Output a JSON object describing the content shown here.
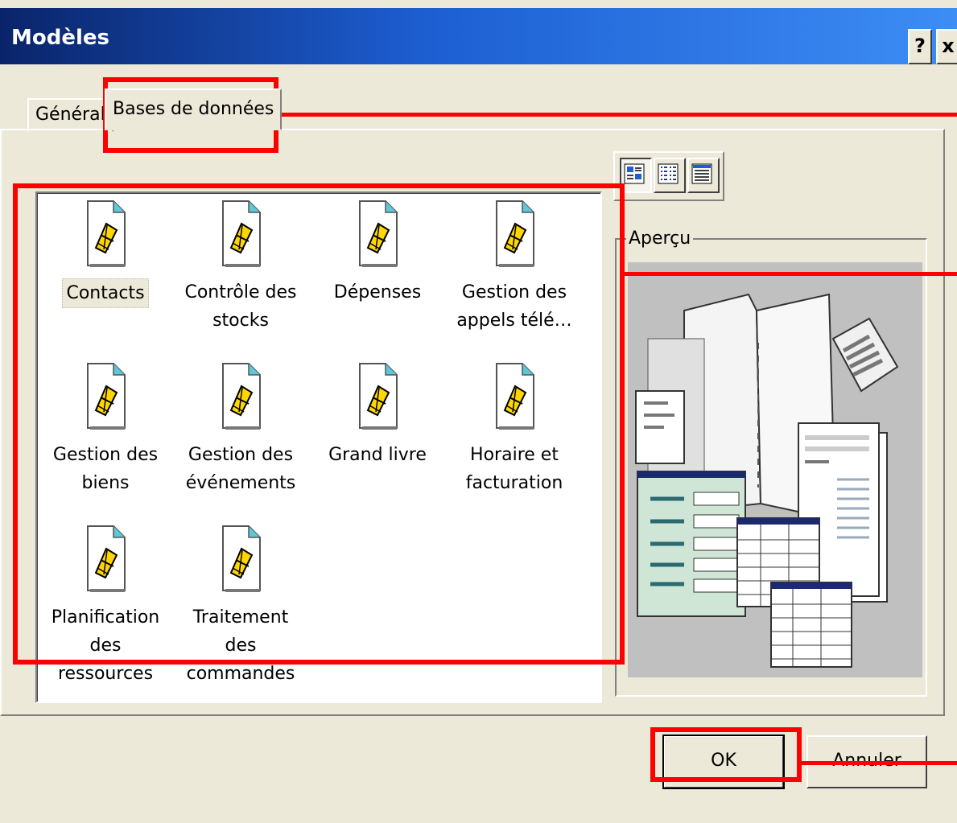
{
  "window": {
    "title": "Modèles",
    "help_btn": "?",
    "close_btn": "x"
  },
  "tabs": [
    {
      "label": "Général",
      "active": false
    },
    {
      "label": "Bases de données",
      "active": true
    }
  ],
  "templates": [
    {
      "label_line1": "Contacts",
      "label_line2": "",
      "icon": "database-template-icon",
      "selected": true
    },
    {
      "label_line1": "Contrôle des",
      "label_line2": "stocks",
      "icon": "database-template-icon",
      "selected": false
    },
    {
      "label_line1": "Dépenses",
      "label_line2": "",
      "icon": "database-template-icon",
      "selected": false
    },
    {
      "label_line1": "Gestion des",
      "label_line2": "appels télé…",
      "icon": "database-template-icon",
      "selected": false
    },
    {
      "label_line1": "Gestion des",
      "label_line2": "biens",
      "icon": "database-template-icon",
      "selected": false
    },
    {
      "label_line1": "Gestion des",
      "label_line2": "événements",
      "icon": "database-template-icon",
      "selected": false
    },
    {
      "label_line1": "Grand livre",
      "label_line2": "",
      "icon": "database-template-icon",
      "selected": false
    },
    {
      "label_line1": "Horaire et",
      "label_line2": "facturation",
      "icon": "database-template-icon",
      "selected": false
    },
    {
      "label_line1": "Planification des",
      "label_line2": "ressources",
      "icon": "database-template-icon",
      "selected": false
    },
    {
      "label_line1": "Traitement des",
      "label_line2": "commandes",
      "icon": "database-template-icon",
      "selected": false
    }
  ],
  "view_buttons": [
    {
      "icon": "large-icons-view-icon",
      "pressed": true
    },
    {
      "icon": "list-view-icon",
      "pressed": false
    },
    {
      "icon": "details-view-icon",
      "pressed": false
    }
  ],
  "preview": {
    "label": "Aperçu",
    "image": "database-preview-illustration"
  },
  "buttons": {
    "ok": "OK",
    "cancel": "Annuler"
  },
  "colors": {
    "titlebar_start": "#0a246a",
    "titlebar_end": "#3d8df5",
    "dialog_bg": "#ece9d8",
    "annotation": "#ff0000"
  }
}
